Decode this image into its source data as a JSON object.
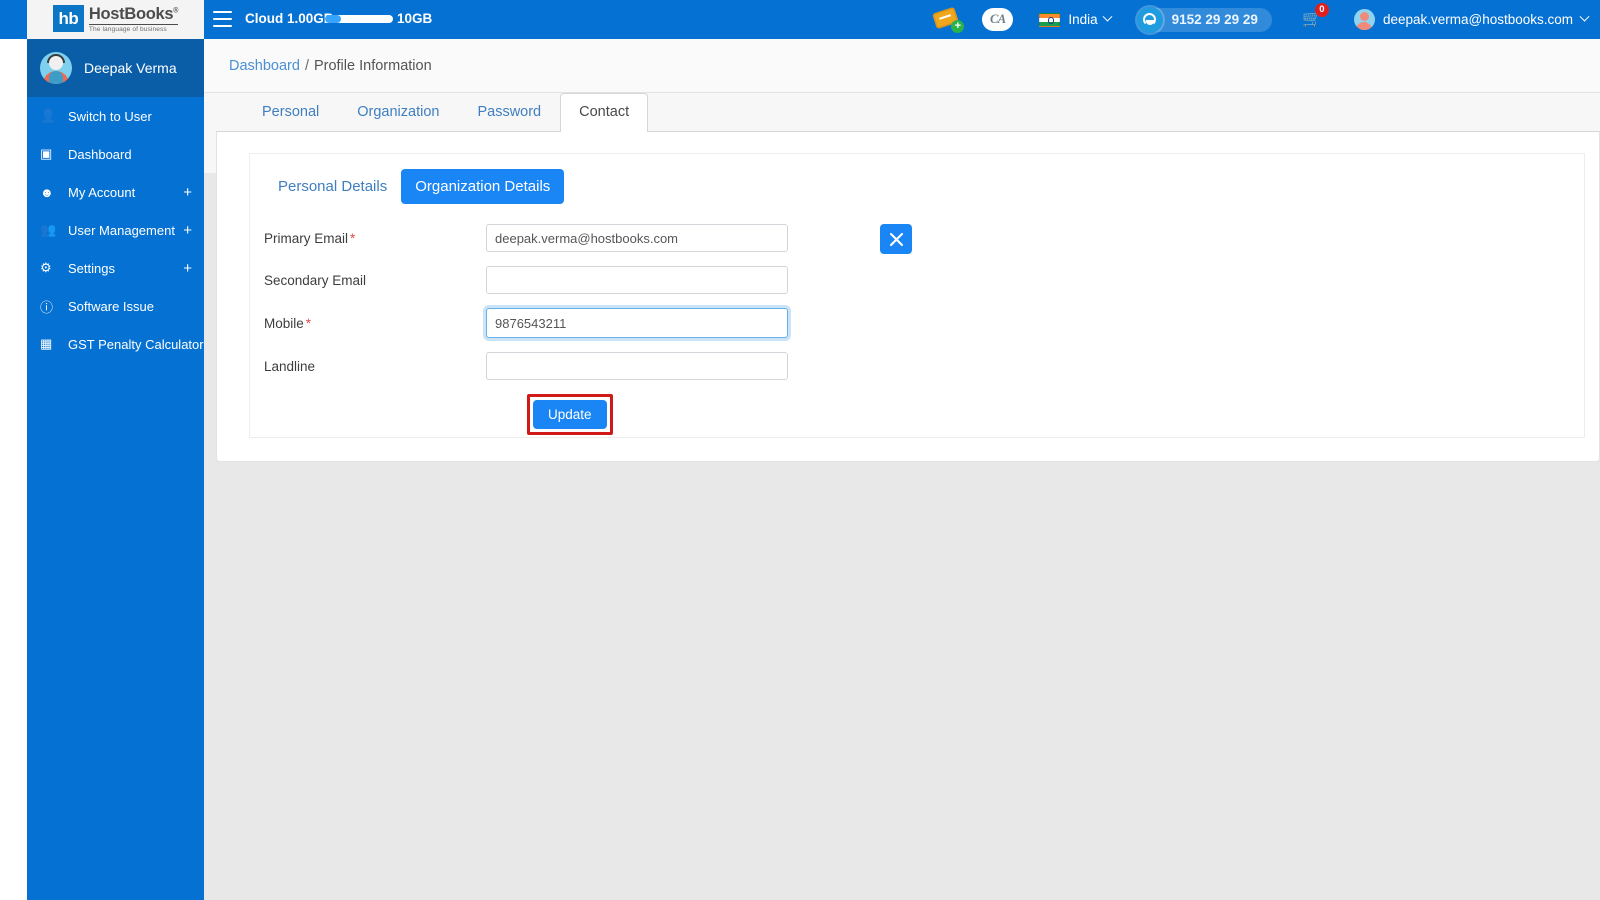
{
  "topbar": {
    "logo": {
      "mark": "hb",
      "name": "HostBooks",
      "registered": "®",
      "tagline": "The language of business"
    },
    "menu_icon": "hamburger-icon",
    "cloud_label": "Cloud 1.00GB",
    "cloud_used_percent": 24,
    "cloud_max": "10GB",
    "ticket_icon": "add-ticket-icon",
    "ca_icon": "CA",
    "country": "India",
    "support_phone": "9152 29 29 29",
    "cart_badge": "0",
    "user_email": "deepak.verma@hostbooks.com"
  },
  "sidebar": {
    "profile_name": "Deepak Verma",
    "items": [
      {
        "label": "Switch to User",
        "icon": "user-icon",
        "expandable": false,
        "plus": ""
      },
      {
        "label": "Dashboard",
        "icon": "dashboard-icon",
        "expandable": false,
        "plus": ""
      },
      {
        "label": "My Account",
        "icon": "account-circle-icon",
        "expandable": true,
        "plus": "+"
      },
      {
        "label": "User Management",
        "icon": "users-group-icon",
        "expandable": true,
        "plus": "+"
      },
      {
        "label": "Settings",
        "icon": "gear-icon",
        "expandable": true,
        "plus": "+"
      },
      {
        "label": "Software Issue",
        "icon": "info-icon",
        "expandable": false,
        "plus": ""
      },
      {
        "label": "GST Penalty Calculator",
        "icon": "calculator-icon",
        "expandable": false,
        "plus": ""
      }
    ]
  },
  "breadcrumb": {
    "root": "Dashboard",
    "separator": "/",
    "current": "Profile Information"
  },
  "tabs": [
    {
      "label": "Personal",
      "active": false
    },
    {
      "label": "Organization",
      "active": false
    },
    {
      "label": "Password",
      "active": false
    },
    {
      "label": "Contact",
      "active": true
    }
  ],
  "segments": [
    {
      "label": "Personal Details",
      "active": false
    },
    {
      "label": "Organization Details",
      "active": true
    }
  ],
  "close_button": {
    "icon": "close-icon",
    "label": "×"
  },
  "form": {
    "fields": [
      {
        "label": "Primary Email",
        "required": "*",
        "value": "deepak.verma@hostbooks.com",
        "placeholder": "",
        "focused": false
      },
      {
        "label": "Secondary Email",
        "required": "",
        "value": "",
        "placeholder": "",
        "focused": false
      },
      {
        "label": "Mobile",
        "required": "*",
        "value": "9876543211",
        "placeholder": "",
        "focused": true
      },
      {
        "label": "Landline",
        "required": "",
        "value": "",
        "placeholder": "",
        "focused": false
      }
    ],
    "submit_label": "Update"
  },
  "colors": {
    "brand_blue": "#0571d3",
    "accent_blue": "#1a85f5",
    "link_blue": "#3f7fc1",
    "highlight_red": "#d11a18",
    "page_bg": "#e8e8e8"
  }
}
